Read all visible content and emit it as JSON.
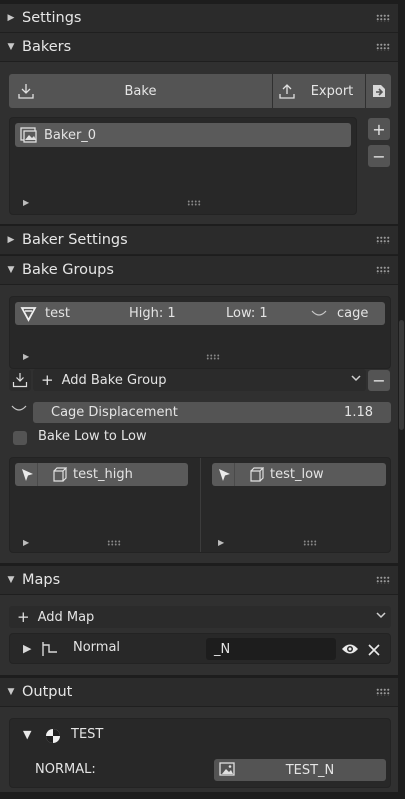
{
  "panels": {
    "settings": "Settings",
    "bakers": "Bakers",
    "baker_settings": "Baker Settings",
    "bake_groups": "Bake Groups",
    "maps": "Maps",
    "output": "Output"
  },
  "bakers": {
    "bake_label": "Bake",
    "export_label": "Export",
    "items": [
      {
        "label": "Baker_0"
      }
    ]
  },
  "bake_groups": {
    "group": {
      "name": "test",
      "high": "High: 1",
      "low": "Low: 1",
      "cage": "cage"
    },
    "add_label": "Add Bake Group",
    "cage_displacement_label": "Cage Displacement",
    "cage_displacement_value": "1.18",
    "bake_low_to_low_label": "Bake Low to Low",
    "bake_low_to_low_checked": false,
    "high_items": [
      {
        "label": "test_high"
      }
    ],
    "low_items": [
      {
        "label": "test_low"
      }
    ]
  },
  "maps": {
    "add_label": "Add Map",
    "items": [
      {
        "label": "Normal",
        "suffix": "_N"
      }
    ]
  },
  "output": {
    "name": "TEST",
    "rows": [
      {
        "label": "NORMAL:",
        "value": "TEST_N"
      }
    ]
  },
  "colors": {
    "background": "#303030",
    "header": "#2b2b2b",
    "button": "#545454",
    "selected_row": "#5a5a5a"
  }
}
